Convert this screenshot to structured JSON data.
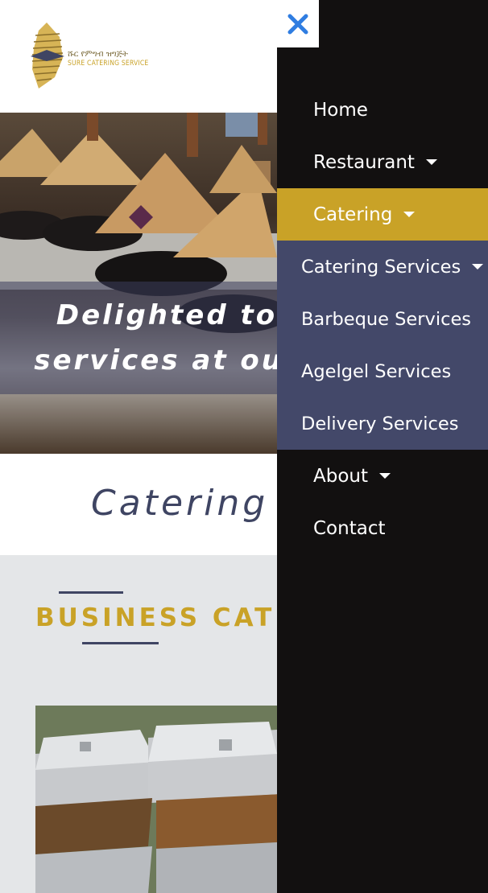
{
  "header": {
    "logo_amharic": "ሹር የምግብ ዝግጅት",
    "logo_english": "SURE CATERING SERVICE"
  },
  "hero": {
    "line1": "Delighted to",
    "line2": "services at our"
  },
  "section": {
    "title": "Catering S"
  },
  "business": {
    "title": "BUSINESS CATER"
  },
  "drawer": {
    "close_icon": "close-x-icon",
    "items": [
      {
        "label": "Home",
        "has_caret": false
      },
      {
        "label": "Restaurant",
        "has_caret": true
      },
      {
        "label": "Catering",
        "has_caret": true,
        "active": true
      },
      {
        "label": "About",
        "has_caret": true
      },
      {
        "label": "Contact",
        "has_caret": false
      }
    ],
    "submenu": [
      {
        "label": "Catering Services",
        "has_caret": true
      },
      {
        "label": "Barbeque Services",
        "has_caret": false
      },
      {
        "label": "Agelgel Services",
        "has_caret": false
      },
      {
        "label": "Delivery Services",
        "has_caret": false
      }
    ]
  },
  "colors": {
    "accent_gold": "#c9a227",
    "submenu_bg": "#434869",
    "drawer_bg": "#121010",
    "close_icon": "#2f7de1"
  }
}
